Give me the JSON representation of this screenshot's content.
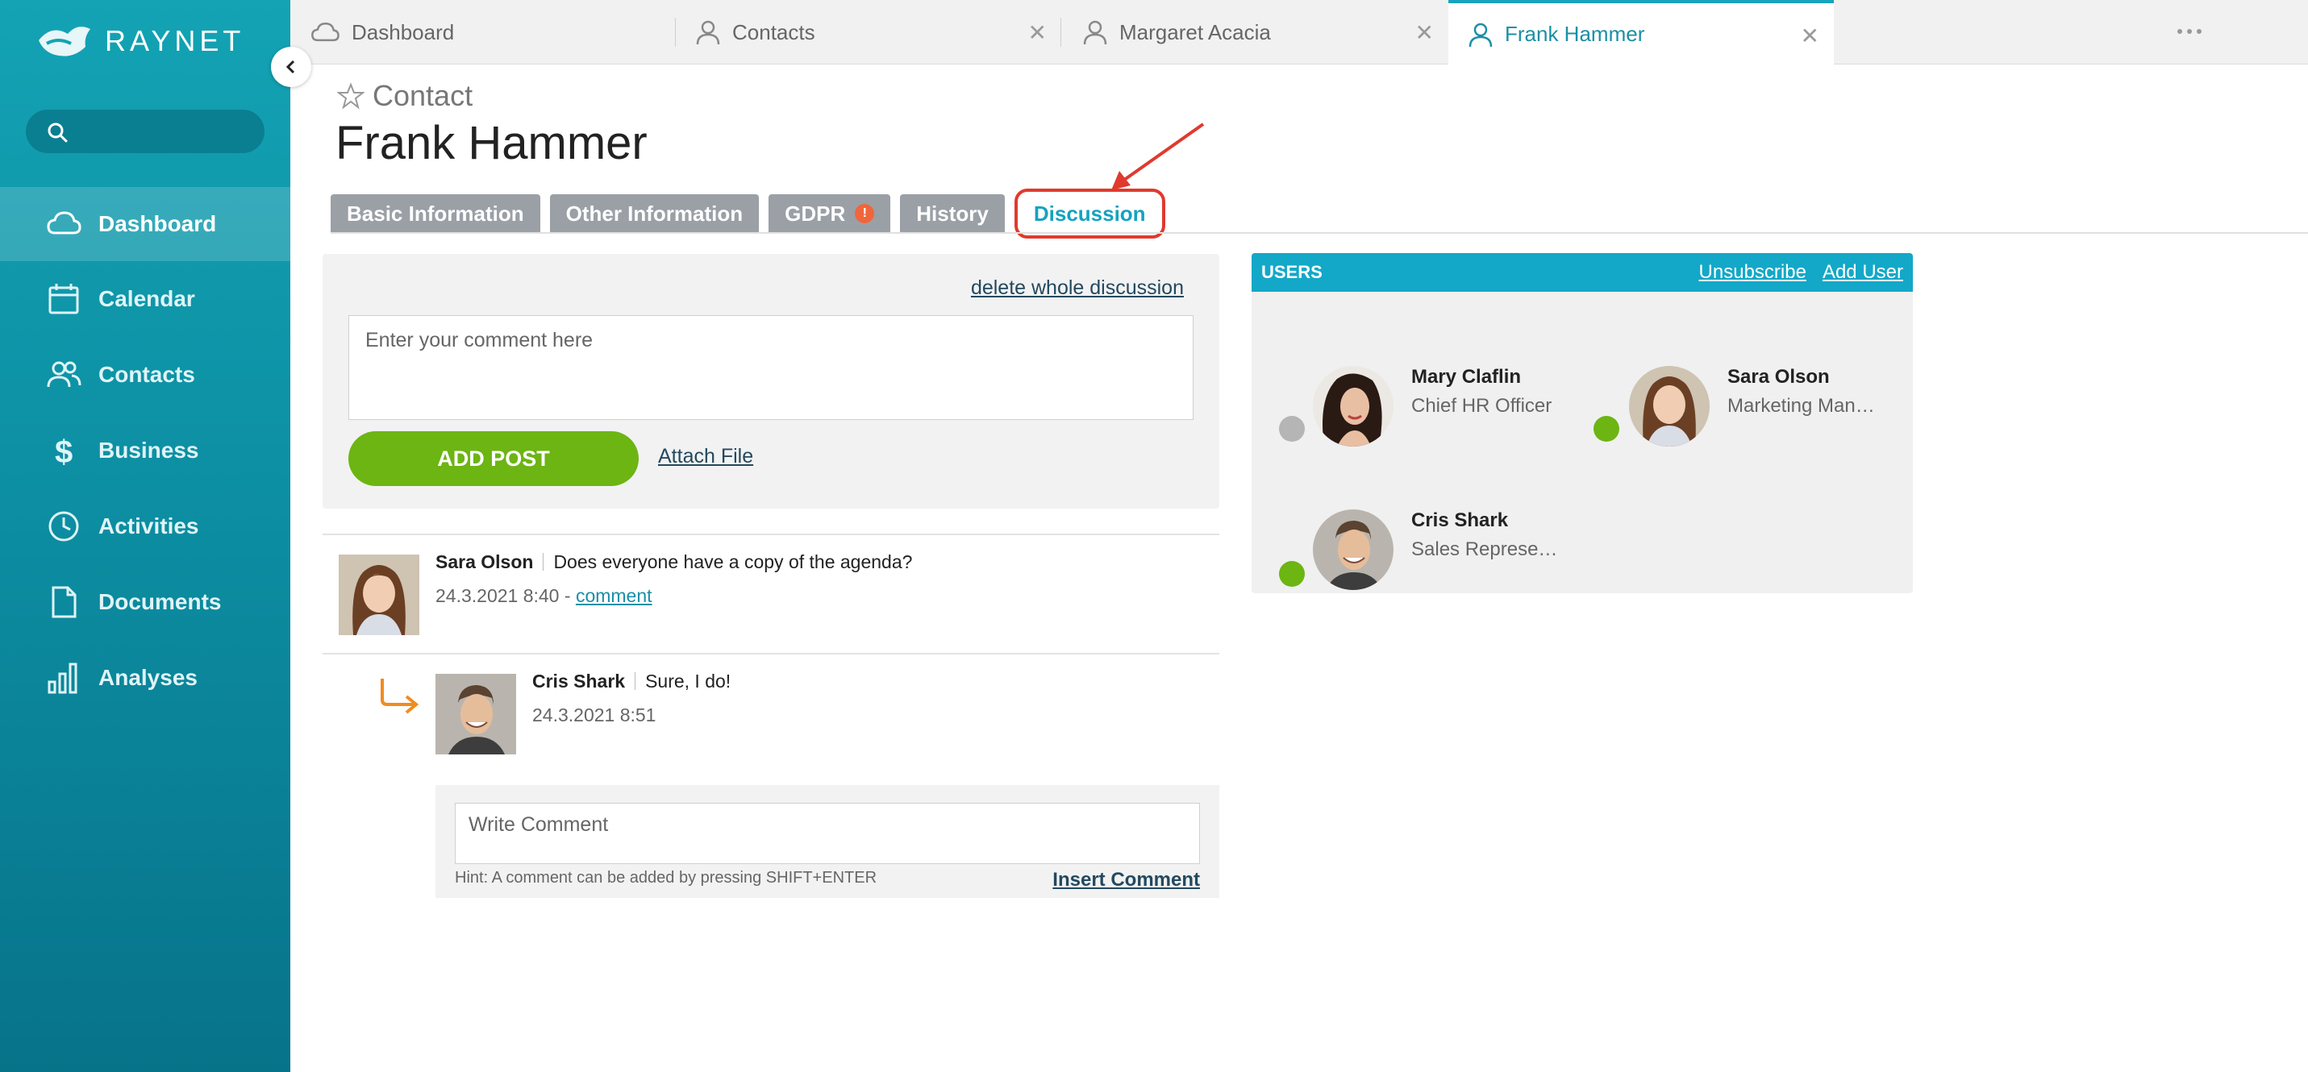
{
  "app": {
    "logo_text": "RAYNET",
    "brand_color": "#13a3b4"
  },
  "sidebar": {
    "search_placeholder": "",
    "items": [
      {
        "label": "Dashboard",
        "icon": "cloud-icon",
        "active": true
      },
      {
        "label": "Calendar",
        "icon": "calendar-icon"
      },
      {
        "label": "Contacts",
        "icon": "contacts-icon"
      },
      {
        "label": "Business",
        "icon": "dollar-icon"
      },
      {
        "label": "Activities",
        "icon": "clock-icon"
      },
      {
        "label": "Documents",
        "icon": "document-icon"
      },
      {
        "label": "Analyses",
        "icon": "bar-chart-icon"
      }
    ]
  },
  "window_tabs": [
    {
      "label": "Dashboard",
      "icon": "cloud-icon",
      "closable": false
    },
    {
      "label": "Contacts",
      "icon": "person-icon",
      "closable": true
    },
    {
      "label": "Margaret Acacia",
      "icon": "person-icon",
      "closable": true
    },
    {
      "label": "Frank Hammer",
      "icon": "person-icon",
      "closable": true,
      "active": true
    }
  ],
  "header": {
    "type_label": "Contact",
    "name": "Frank Hammer"
  },
  "content_tabs": [
    {
      "label": "Basic Information"
    },
    {
      "label": "Other Information"
    },
    {
      "label": "GDPR",
      "warning": "!"
    },
    {
      "label": "History"
    },
    {
      "label": "Discussion",
      "active": true
    }
  ],
  "discussion": {
    "delete_link": "delete whole discussion",
    "comment_placeholder": "Enter your comment here",
    "add_post_label": "ADD POST",
    "attach_label": "Attach File",
    "posts": [
      {
        "author": "Sara Olson",
        "text": "Does everyone have a copy of the agenda?",
        "timestamp": "24.3.2021 8:40",
        "separator": " - ",
        "comment_link": "comment"
      }
    ],
    "replies": [
      {
        "author": "Cris Shark",
        "text": "Sure, I do!",
        "timestamp": "24.3.2021 8:51"
      }
    ],
    "write_comment_placeholder": "Write Comment",
    "hint": "Hint: A comment can be added by pressing SHIFT+ENTER",
    "insert_label": "Insert Comment"
  },
  "users_panel": {
    "title": "USERS",
    "unsubscribe_label": "Unsubscribe",
    "add_user_label": "Add User",
    "users": [
      {
        "name": "Mary Claflin",
        "role": "Chief HR Officer",
        "status": "offline",
        "status_color": "#b5b5b5"
      },
      {
        "name": "Sara Olson",
        "role": "Marketing Man…",
        "status": "online",
        "status_color": "#6cb513"
      },
      {
        "name": "Cris Shark",
        "role": "Sales Represe…",
        "status": "online",
        "status_color": "#6cb513"
      }
    ]
  }
}
